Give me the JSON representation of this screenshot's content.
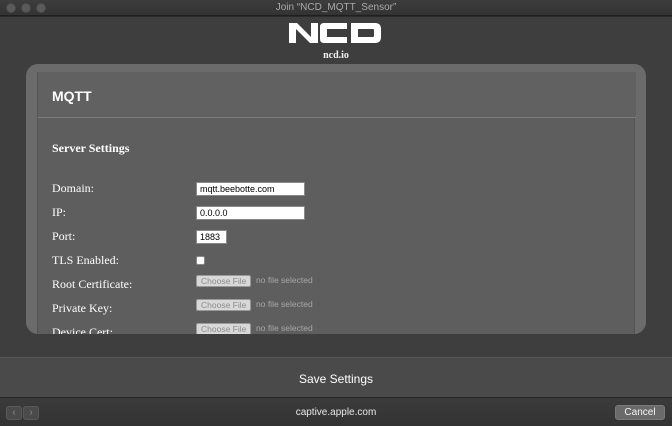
{
  "window": {
    "title": "Join “NCD_MQTT_Sensor”"
  },
  "header": {
    "logo_text": "NCD",
    "logo_subtitle": "ncd.io"
  },
  "card": {
    "title": "MQTT",
    "section_title": "Server Settings",
    "fields": {
      "domain": {
        "label": "Domain:",
        "value": "mqtt.beebotte.com"
      },
      "ip": {
        "label": "IP:",
        "value": "0.0.0.0"
      },
      "port": {
        "label": "Port:",
        "value": "1883"
      },
      "tls": {
        "label": "TLS Enabled:",
        "checked": false
      },
      "root_cert": {
        "label": "Root Certificate:",
        "button": "Choose File",
        "status": "no file selected"
      },
      "private_key": {
        "label": "Private Key:",
        "button": "Choose File",
        "status": "no file selected"
      },
      "device_cert": {
        "label": "Device Cert:",
        "button": "Choose File",
        "status": "no file selected"
      }
    }
  },
  "footer": {
    "save_label": "Save Settings"
  },
  "bottom_bar": {
    "back": "‹",
    "forward": "›",
    "url": "captive.apple.com",
    "cancel_label": "Cancel"
  }
}
